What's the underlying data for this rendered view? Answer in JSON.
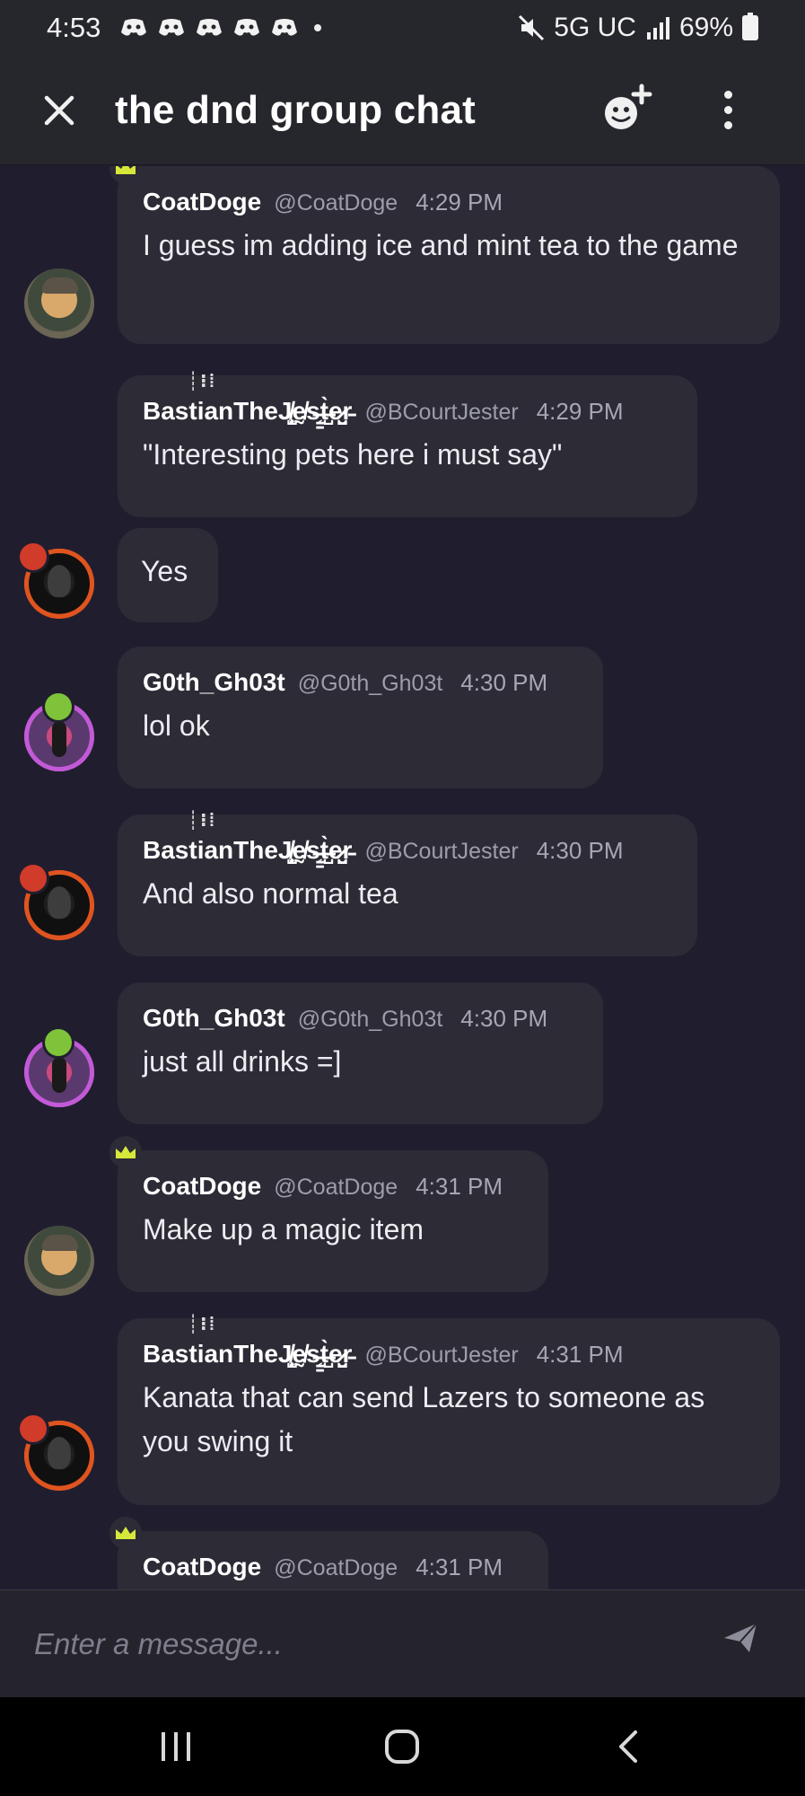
{
  "status_bar": {
    "time": "4:53",
    "network": "5G UC",
    "battery": "69%",
    "notification_icons": [
      "discord-icon",
      "discord-icon",
      "discord-icon",
      "discord-icon",
      "discord-icon"
    ],
    "mute_icon": "muted-speaker-icon",
    "signal_icon": "signal-bars-icon"
  },
  "header": {
    "title": "the dnd group chat",
    "close_icon": "close-icon",
    "add_member_icon": "add-member-icon",
    "more_icon": "more-vertical-icon"
  },
  "messages": [
    {
      "author": "CoatDoge",
      "handle": "@CoatDoge",
      "time": "4:29 PM",
      "text": "I guess im adding ice and mint tea to the game",
      "avatar": "coatdoge-avatar",
      "crown": true
    },
    {
      "author": "BastianTheJ̸̨̺̗̜ḛ̸s̶̳͔t̶̺̀e̷̮̺r̵",
      "handle": "@BCourtJester",
      "time": "4:29 PM",
      "text": "\"Interesting pets here i must say\"",
      "avatar": "jester-avatar"
    },
    {
      "text": "Yes",
      "avatar": "jester-avatar"
    },
    {
      "author": "G0th_Gh03t",
      "handle": "@G0th_Gh03t",
      "time": "4:30 PM",
      "text": "lol ok",
      "avatar": "goth-avatar"
    },
    {
      "author": "BastianTheJ̸̨̺̗̜ḛ̸s̶̳͔t̶̺̀e̷̮̺r̵",
      "handle": "@BCourtJester",
      "time": "4:30 PM",
      "text": "And also normal tea",
      "avatar": "jester-avatar"
    },
    {
      "author": "G0th_Gh03t",
      "handle": "@G0th_Gh03t",
      "time": "4:30 PM",
      "text": "just all drinks =]",
      "avatar": "goth-avatar"
    },
    {
      "author": "CoatDoge",
      "handle": "@CoatDoge",
      "time": "4:31 PM",
      "text": "Make up a magic item",
      "avatar": "coatdoge-avatar",
      "crown": true
    },
    {
      "author": "BastianTheJ̸̨̺̗̜ḛ̸s̶̳͔t̶̺̀e̷̮̺r̵",
      "handle": "@BCourtJester",
      "time": "4:31 PM",
      "text": "Kanata that can send Lazers to someone as you swing it",
      "avatar": "jester-avatar"
    },
    {
      "author": "CoatDoge",
      "handle": "@CoatDoge",
      "time": "4:31 PM",
      "text": "",
      "avatar": "coatdoge-avatar",
      "crown": true
    }
  ],
  "composer": {
    "placeholder": "Enter a message...",
    "send_icon": "send-icon"
  },
  "navbar": {
    "recents_icon": "recent-apps-icon",
    "home_icon": "home-icon",
    "back_icon": "back-icon"
  },
  "colors": {
    "background": "#201e2e",
    "bubble": "#2c2b36",
    "header": "#26262d",
    "crown": "#d6e83a"
  }
}
